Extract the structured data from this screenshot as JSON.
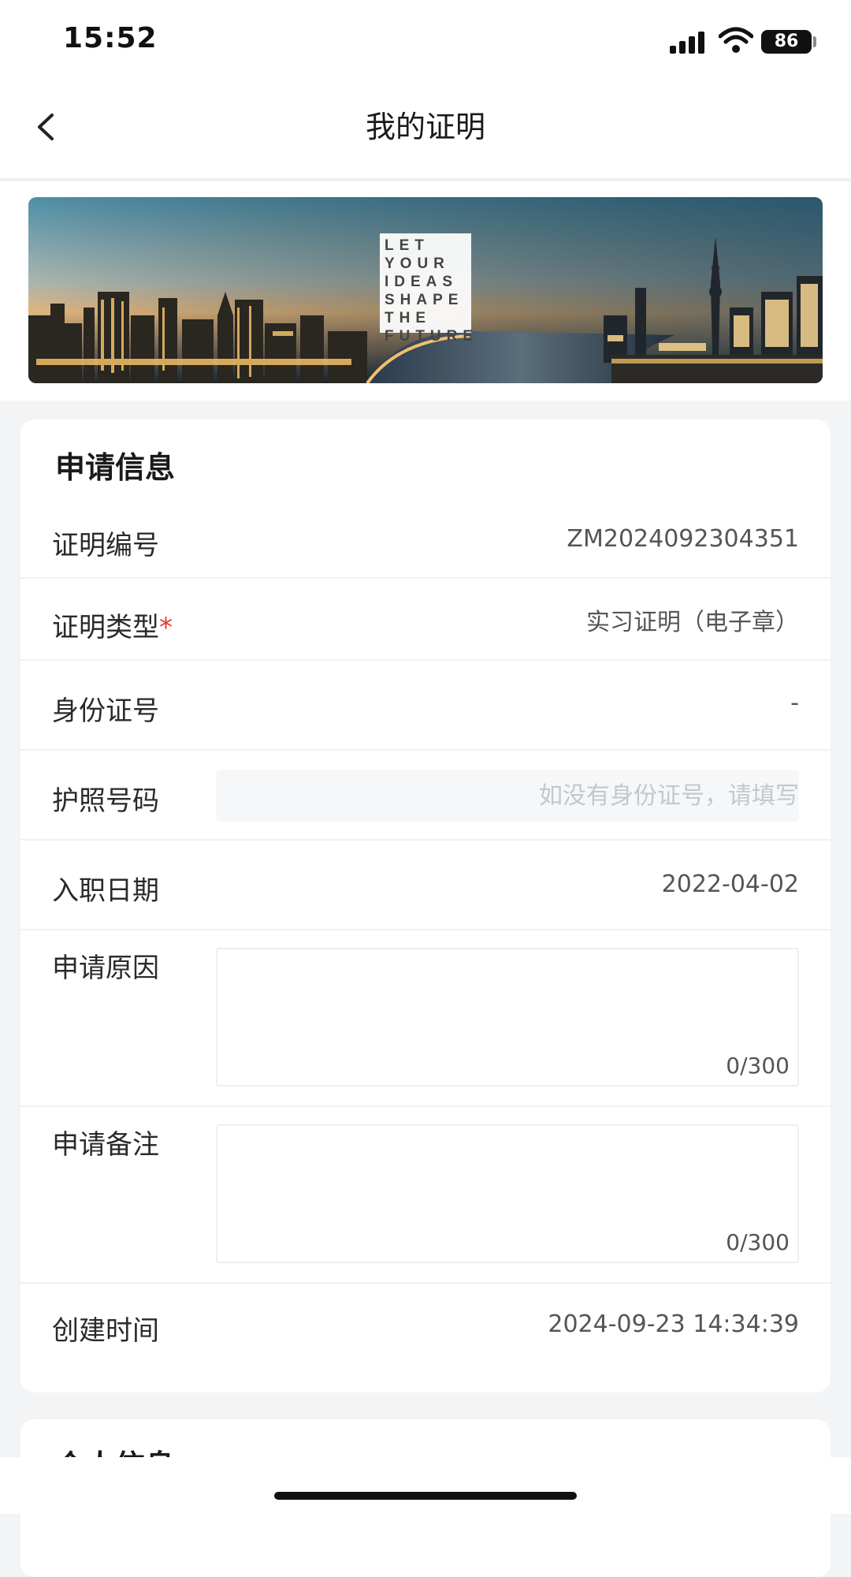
{
  "status_bar": {
    "time": "15:52",
    "battery": "86"
  },
  "nav": {
    "title": "我的证明"
  },
  "banner": {
    "logo_lines": [
      "LET",
      "YOUR",
      "IDEAS",
      "SHAPE",
      "THE",
      "FUTURE"
    ]
  },
  "application_info": {
    "title": "申请信息",
    "certificate_number": {
      "label": "证明编号",
      "value": "ZM2024092304351"
    },
    "certificate_type": {
      "label": "证明类型",
      "required_mark": "*",
      "value": "实习证明（电子章）"
    },
    "id_number": {
      "label": "身份证号",
      "value": "-"
    },
    "passport": {
      "label": "护照号码",
      "placeholder": "如没有身份证号，请填写",
      "value": ""
    },
    "hire_date": {
      "label": "入职日期",
      "value": "2022-04-02"
    },
    "reason": {
      "label": "申请原因",
      "counter": "0/300"
    },
    "remarks": {
      "label": "申请备注",
      "counter": "0/300"
    },
    "created_time": {
      "label": "创建时间",
      "value": "2024-09-23 14:34:39"
    }
  },
  "personal_info": {
    "title": "个人信息"
  },
  "colors": {
    "required": "#e53935",
    "background": "#f3f4f6",
    "card": "#ffffff"
  }
}
